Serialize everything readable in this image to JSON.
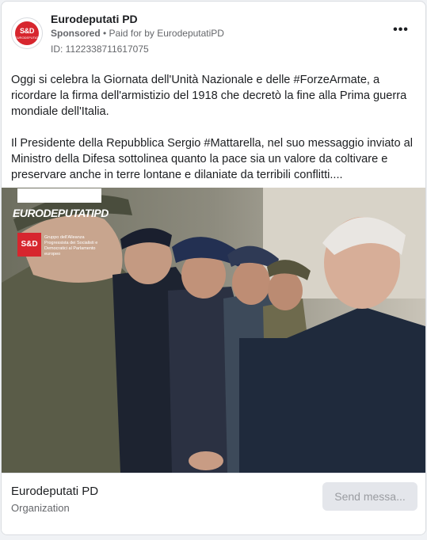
{
  "ad": {
    "page_name": "Eurodeputati PD",
    "sponsored_label": "Sponsored",
    "paid_for_text": " • Paid for by ",
    "payer": "EurodeputatiPD",
    "ad_id": "ID: 1122338711617075",
    "more_label": "•••",
    "avatar_text": "S&D",
    "avatar_subtext": "EURODEPUTATIPD"
  },
  "body": {
    "paragraph1": "Oggi si celebra la Giornata dell'Unità Nazionale e delle #ForzeArmate, a ricordare la firma dell'armistizio del 1918 che decretò la fine alla Prima guerra mondiale dell'Italia.",
    "paragraph2": "Il Presidente della Repubblica Sergio #Mattarella, nel suo messaggio inviato al Ministro della Difesa sottolinea quanto la pace sia un valore da coltivare e preservare anche in terre lontane e dilaniate da terribili conflitti...."
  },
  "image": {
    "logo_text": "EURODEPUTATIPD",
    "badge_text": "S&D",
    "badge_caption": "Gruppo dell'Alleanza Progressista dei Socialisti e Democratici al Parlamento europeo"
  },
  "footer": {
    "name": "Eurodeputati PD",
    "type": "Organization",
    "cta_label": "Send messa..."
  }
}
